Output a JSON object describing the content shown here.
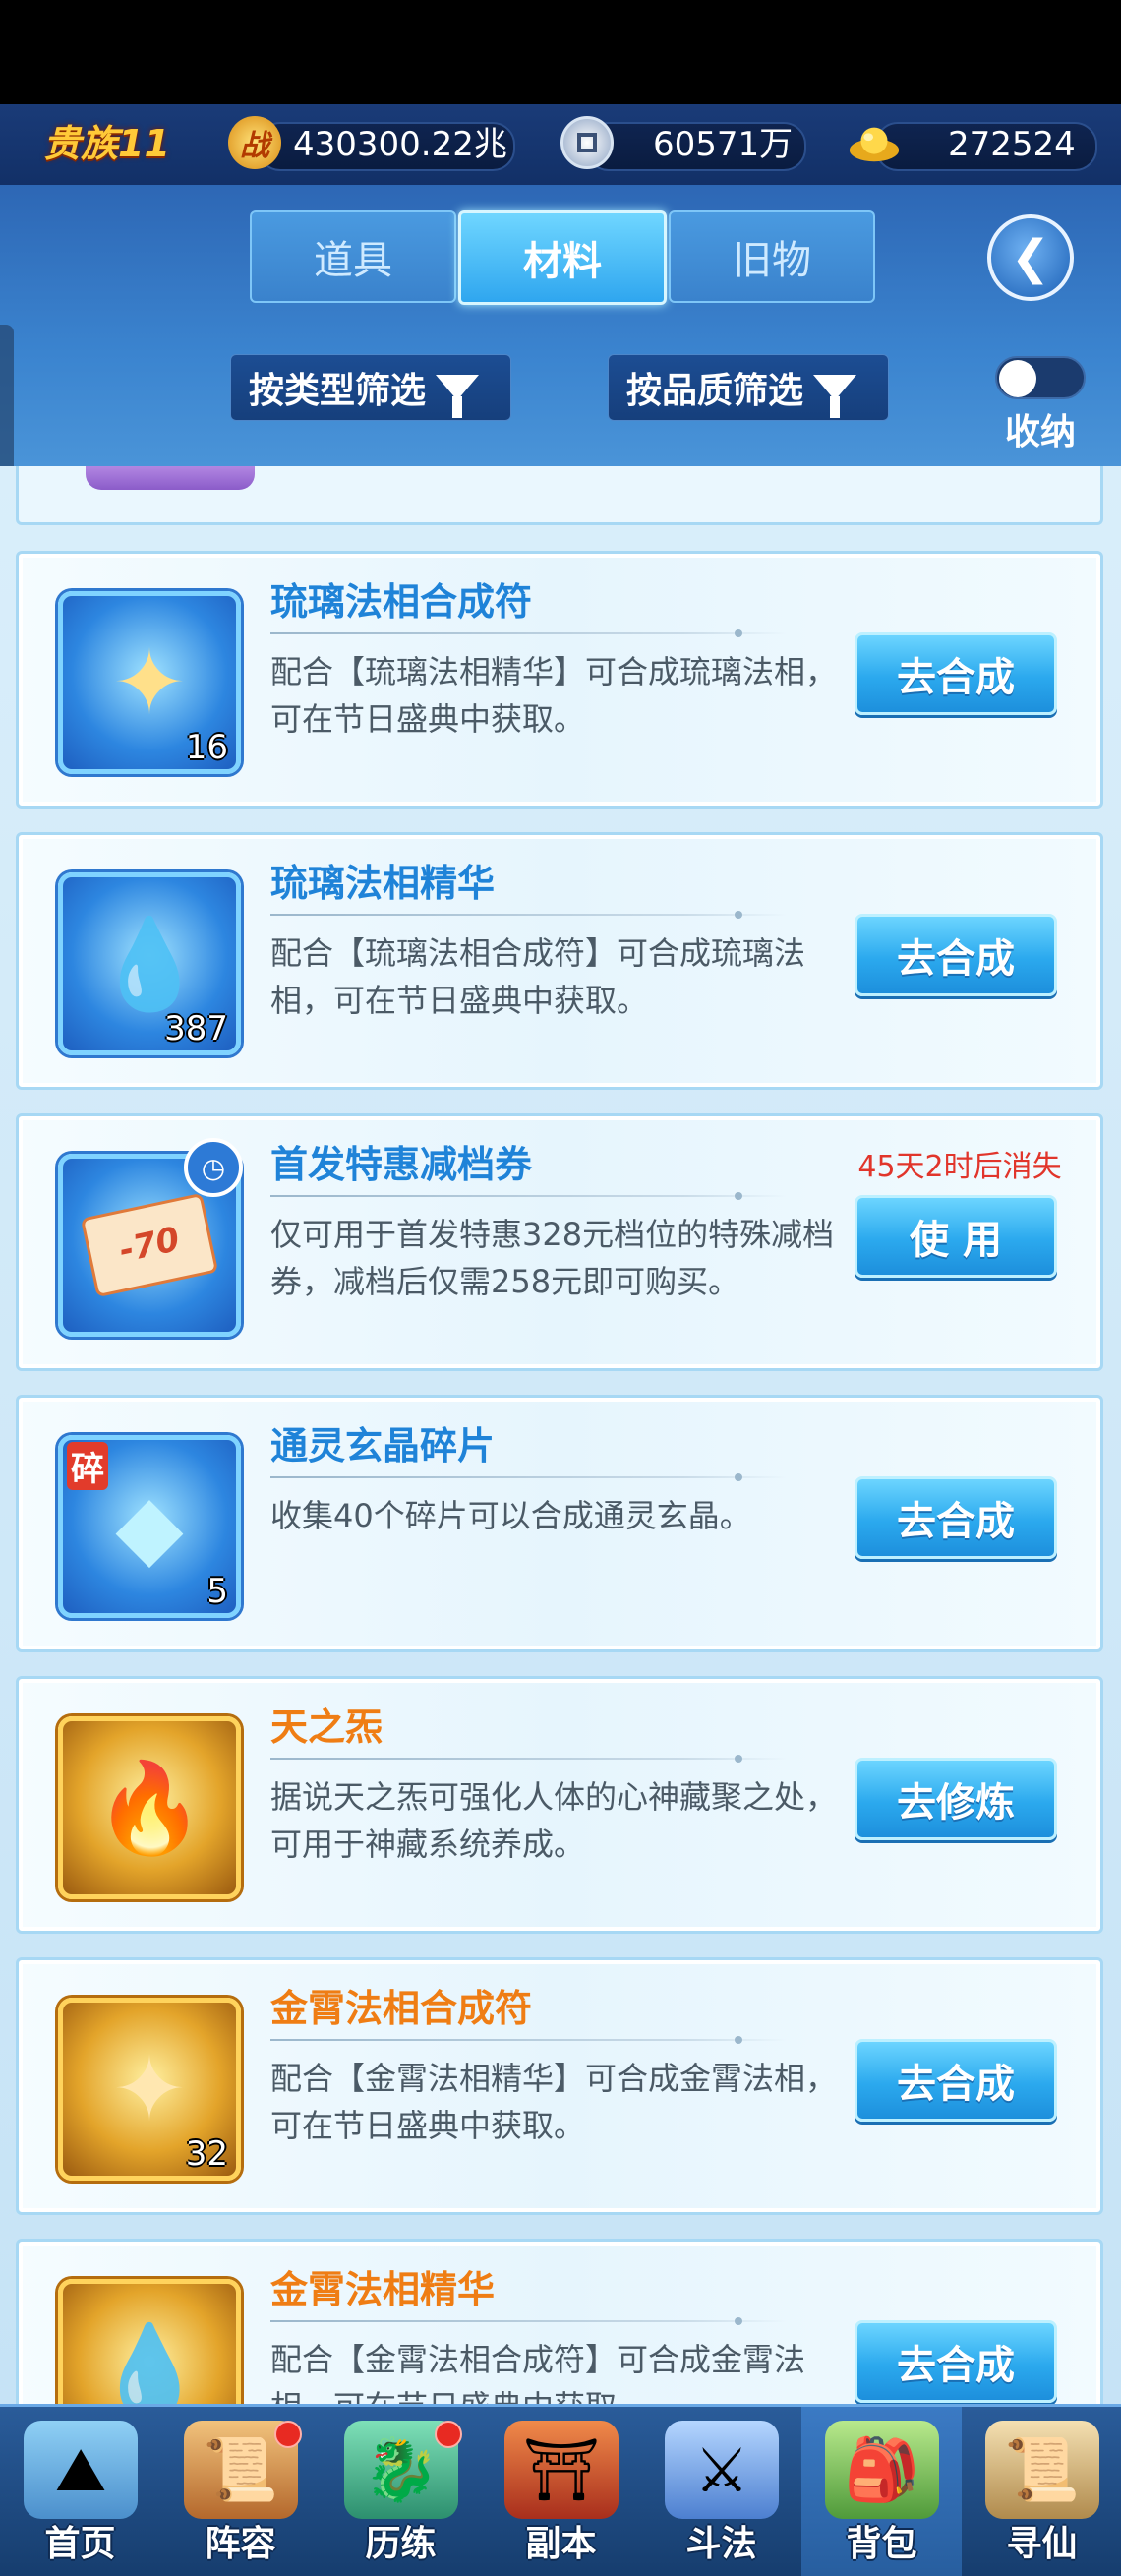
{
  "resources": {
    "noble_label": "贵族11",
    "power_icon": "战",
    "power_value": "430300.22兆",
    "coin_value": "60571万",
    "gold_value": "272524"
  },
  "tabs": [
    {
      "label": "道具",
      "active": false
    },
    {
      "label": "材料",
      "active": true
    },
    {
      "label": "旧物",
      "active": false
    }
  ],
  "filters": {
    "by_type": "按类型筛选",
    "by_quality": "按品质筛选",
    "collapse_label": "收纳"
  },
  "items": [
    {
      "name": "琉璃法相合成符",
      "desc": "配合【琉璃法相精华】可合成琉璃法相，可在节日盛典中获取。",
      "count": "16",
      "button": "去合成",
      "quality": "blue",
      "icon": "talisman-icon"
    },
    {
      "name": "琉璃法相精华",
      "desc": "配合【琉璃法相合成符】可合成琉璃法相，可在节日盛典中获取。",
      "count": "387",
      "button": "去合成",
      "quality": "blue",
      "icon": "essence-icon"
    },
    {
      "name": "首发特惠减档券",
      "desc": "仅可用于首发特惠328元档位的特殊减档券，减档后仅需258元即可购买。",
      "icon_text": "-70",
      "expire": "45天2时后消失",
      "button": "使 用",
      "quality": "blue",
      "icon": "coupon-icon"
    },
    {
      "name": "通灵玄晶碎片",
      "desc": "收集40个碎片可以合成通灵玄晶。",
      "count": "5",
      "tag": "碎",
      "button": "去合成",
      "quality": "blue",
      "icon": "crystal-shard-icon"
    },
    {
      "name": "天之炁",
      "desc": "据说天之炁可强化人体的心神藏聚之处，可用于神藏系统养成。",
      "button": "去修炼",
      "quality": "gold",
      "icon": "flame-icon"
    },
    {
      "name": "金霄法相合成符",
      "desc": "配合【金霄法相精华】可合成金霄法相，可在节日盛典中获取。",
      "count": "32",
      "button": "去合成",
      "quality": "gold",
      "icon": "talisman-icon"
    },
    {
      "name": "金霄法相精华",
      "desc": "配合【金霄法相合成符】可合成金霄法相，可在节日盛典中获取。",
      "button": "去合成",
      "quality": "gold",
      "icon": "essence-icon"
    }
  ],
  "nav": [
    {
      "label": "首页",
      "icon": "home-icon",
      "dot": false,
      "selected": false
    },
    {
      "label": "阵容",
      "icon": "lineup-icon",
      "dot": true,
      "selected": false
    },
    {
      "label": "历练",
      "icon": "training-icon",
      "dot": true,
      "selected": false
    },
    {
      "label": "副本",
      "icon": "dungeon-icon",
      "dot": false,
      "selected": false
    },
    {
      "label": "斗法",
      "icon": "battle-icon",
      "dot": false,
      "selected": false
    },
    {
      "label": "背包",
      "icon": "bag-icon",
      "dot": false,
      "selected": true
    },
    {
      "label": "寻仙",
      "icon": "scroll-icon",
      "dot": false,
      "selected": false
    }
  ],
  "colors": {
    "accent_blue": "#2ba9ee",
    "title_blue": "#1f83d8",
    "title_orange": "#ef7d14",
    "expire_red": "#e1352b"
  }
}
